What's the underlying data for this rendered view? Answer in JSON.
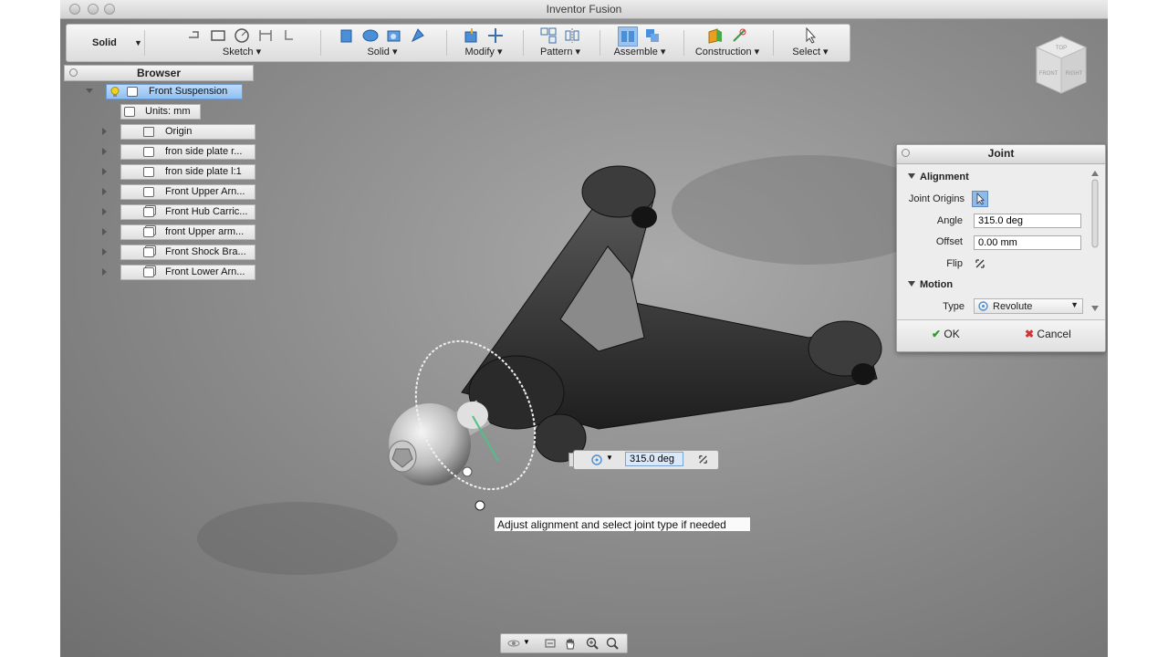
{
  "window": {
    "title": "Inventor Fusion"
  },
  "toolbar": {
    "workspace": "Solid",
    "groups": [
      {
        "label": "Sketch"
      },
      {
        "label": "Solid"
      },
      {
        "label": "Modify"
      },
      {
        "label": "Pattern"
      },
      {
        "label": "Assemble"
      },
      {
        "label": "Construction"
      },
      {
        "label": "Select"
      }
    ]
  },
  "browser": {
    "title": "Browser",
    "root": "Front Suspension",
    "units": "Units: mm",
    "items": [
      {
        "label": "Origin",
        "icon": "folder-icon"
      },
      {
        "label": "fron side plate r...",
        "icon": "component-icon"
      },
      {
        "label": "fron side plate l:1",
        "icon": "component-icon"
      },
      {
        "label": "Front Upper Arn...",
        "icon": "component-icon"
      },
      {
        "label": "Front Hub Carric...",
        "icon": "assembly-icon"
      },
      {
        "label": "front Upper arm...",
        "icon": "assembly-icon"
      },
      {
        "label": "Front Shock Bra...",
        "icon": "assembly-icon"
      },
      {
        "label": "Front Lower Arn...",
        "icon": "assembly-icon"
      }
    ]
  },
  "joint_panel": {
    "title": "Joint",
    "alignment_section": "Alignment",
    "joint_origins_label": "Joint Origins",
    "angle_label": "Angle",
    "angle_value": "315.0 deg",
    "offset_label": "Offset",
    "offset_value": "0.00 mm",
    "flip_label": "Flip",
    "motion_section": "Motion",
    "type_label": "Type",
    "type_value": "Revolute",
    "ok_label": "OK",
    "cancel_label": "Cancel"
  },
  "canvas": {
    "angle_input": "315.0 deg",
    "hint": "Adjust alignment and select joint type if needed"
  },
  "viewcube": {
    "front": "FRONT",
    "right": "RIGHT",
    "top": "TOP"
  },
  "colors": {
    "selection": "#8fc0f1",
    "ok_check": "#2e9a2e",
    "cancel_x": "#d33333",
    "bulb": "#f0d224",
    "active_tool": "#9cc3ee"
  }
}
